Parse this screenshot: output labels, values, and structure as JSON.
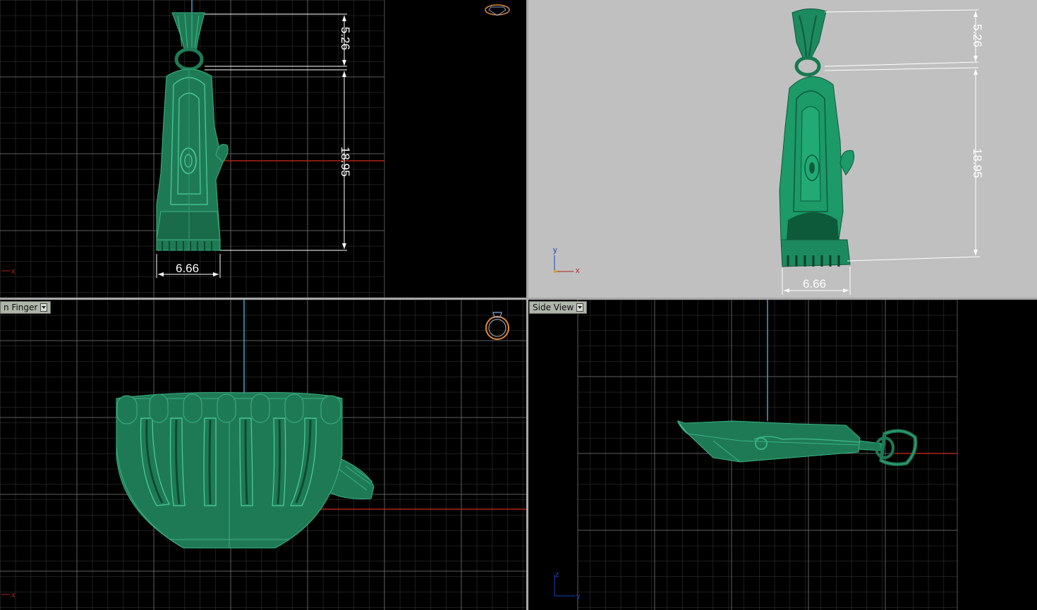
{
  "viewports": {
    "top_left": {
      "dim_vertical_upper": "5.26",
      "dim_vertical_lower": "18.95",
      "dim_horizontal": "6.66",
      "axis_x": "x"
    },
    "top_right": {
      "dim_vertical_upper": "5.26",
      "dim_vertical_lower": "18.95",
      "dim_horizontal": "6.66",
      "axis_x": "x",
      "axis_y": "y"
    },
    "bottom_left": {
      "label": "n Finger",
      "axis_x": "x"
    },
    "bottom_right": {
      "label": "Side View",
      "axis_z": "z",
      "axis_y": "y"
    }
  },
  "colors": {
    "model_green": "#1e7a55",
    "model_highlight": "#39b384",
    "grid_line": "#3c3c3c",
    "grid_major": "#6a6a6a",
    "axis_red": "#b02418",
    "axis_blue": "#4aa0c8",
    "viewport_gray_bg": "#c0c0c0",
    "separator": "#a8a8a8"
  },
  "icons": {
    "top_left_corner": "gem-icon",
    "bottom_left_corner": "ring-icon"
  }
}
